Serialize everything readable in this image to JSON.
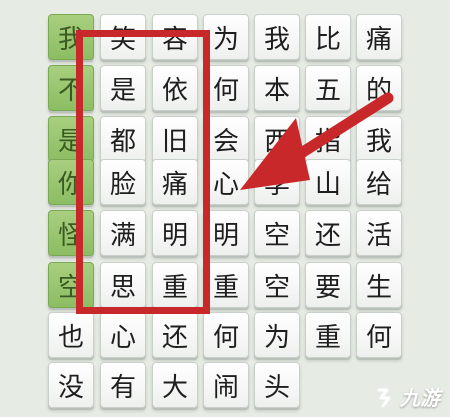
{
  "board": {
    "rows": [
      [
        "我",
        "笑",
        "容",
        "为",
        "我",
        "比",
        "痛"
      ],
      [
        "不",
        "是",
        "依",
        "何",
        "本",
        "五",
        "的"
      ],
      [
        "是",
        "都",
        "旧",
        "会",
        "西",
        "指",
        "我"
      ],
      [
        "你",
        "脸",
        "痛",
        "心",
        "李",
        "山",
        "给"
      ],
      [
        "怪",
        "满",
        "明",
        "明",
        "空",
        "还",
        "活"
      ],
      [
        "空",
        "思",
        "重",
        "重",
        "空",
        "要",
        "生"
      ],
      [
        "也",
        "心",
        "还",
        "何",
        "为",
        "重",
        "何"
      ],
      [
        "没",
        "有",
        "大",
        "闹",
        "头",
        "",
        ""
      ]
    ],
    "highlighted_column": 0,
    "highlighted_rows": 6
  },
  "overlay": {
    "frame_color": "#c9282b",
    "arrow_color": "#c9282b"
  },
  "watermark": {
    "text": "九游",
    "icon": "jiuyou-logo-icon"
  }
}
